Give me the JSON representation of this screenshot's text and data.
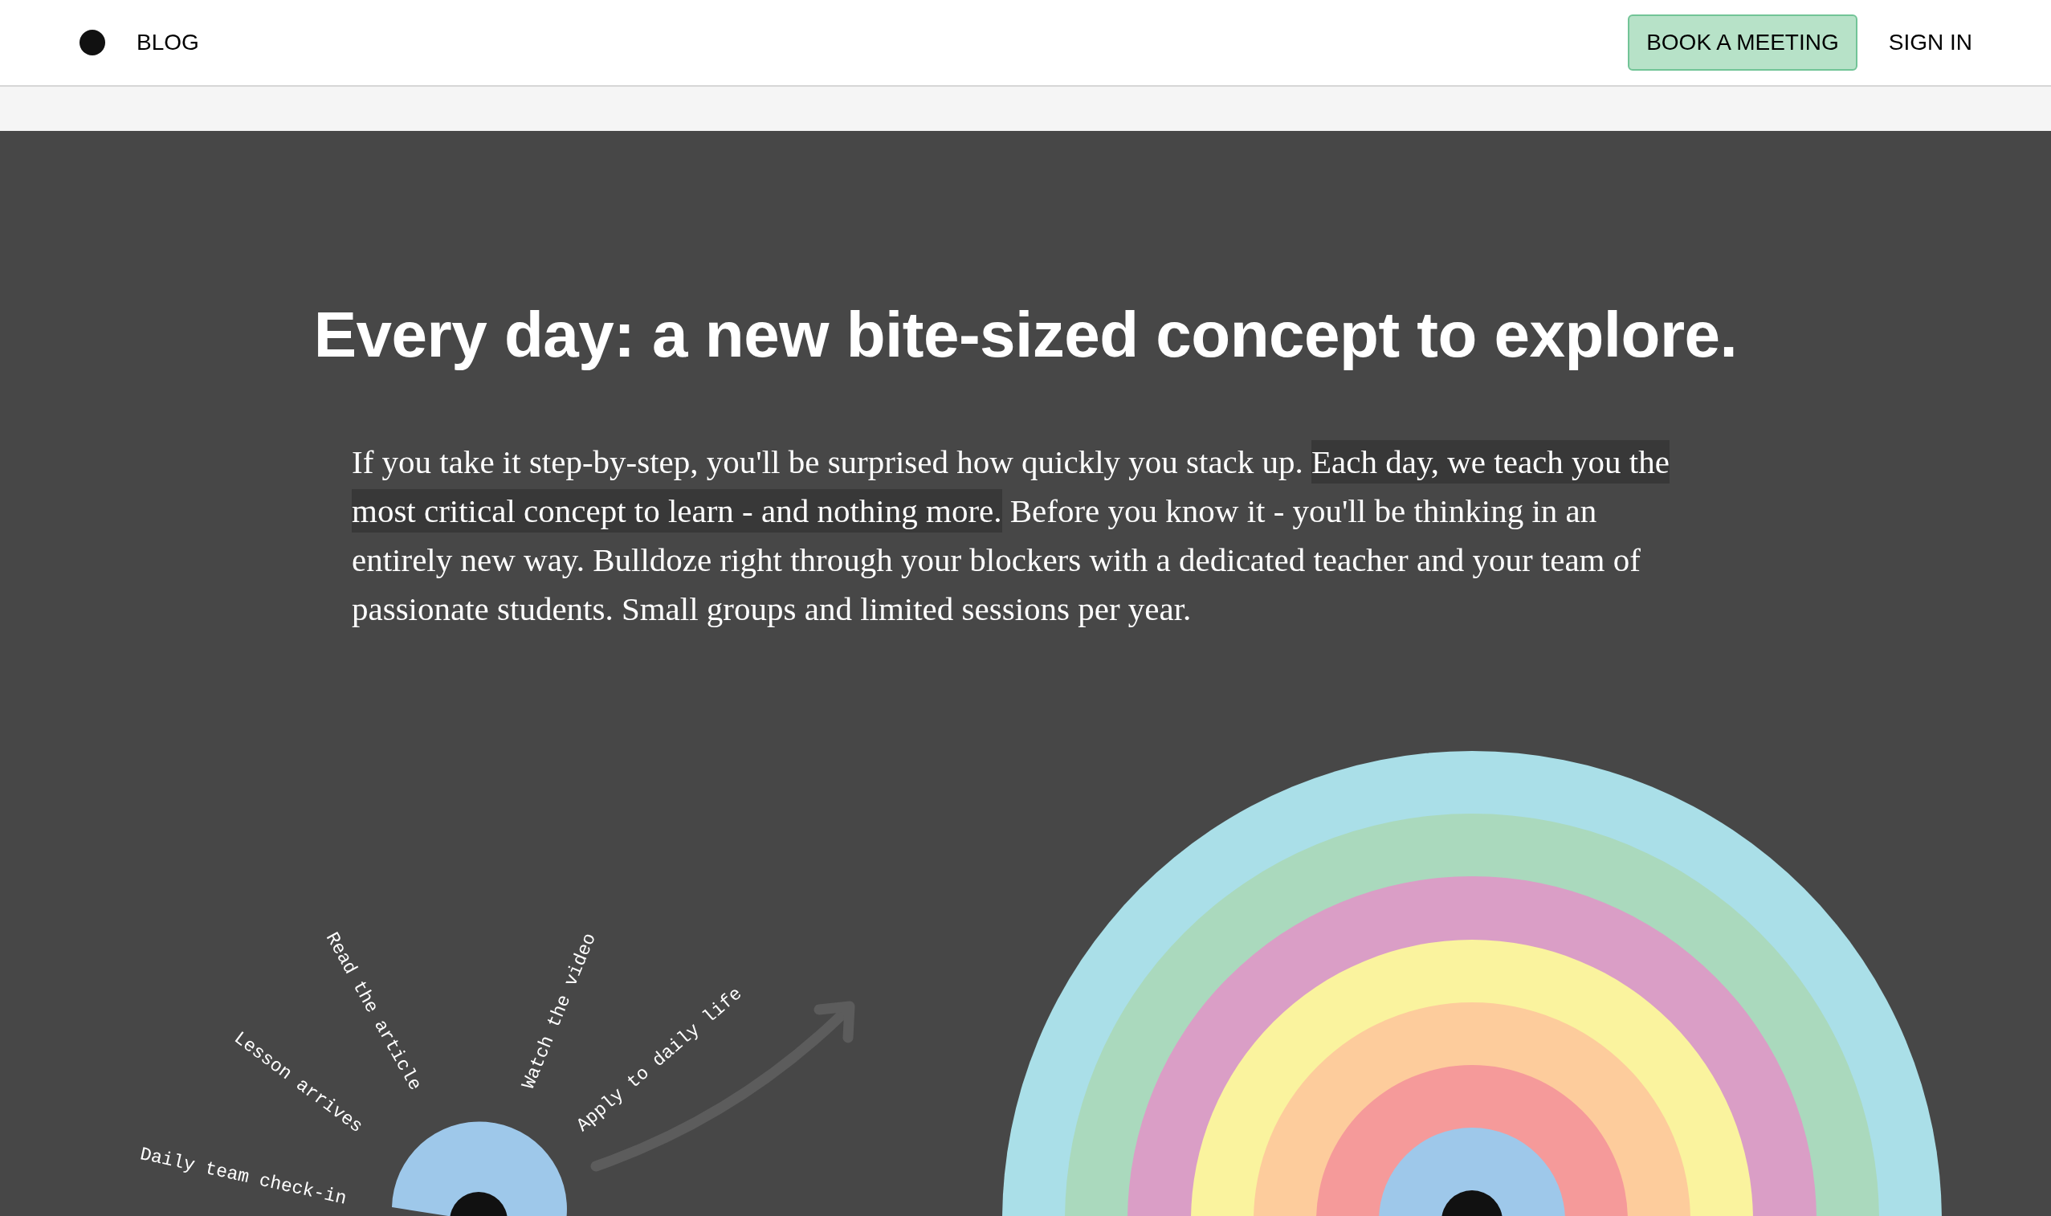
{
  "nav": {
    "blog_link": "BLOG",
    "book_button": "BOOK A MEETING",
    "sign_in_link": "SIGN IN"
  },
  "hero": {
    "title": "Every day: a new bite-sized concept to explore.",
    "paragraph": [
      {
        "text": "If you take it step-by-step, you'll be surprised how quickly you stack up. ",
        "highlighted": false
      },
      {
        "text": "Each day, we teach you the most critical concept to learn - and nothing more.",
        "highlighted": true
      },
      {
        "text": " Before you know it - you'll be thinking in an entirely new way. Bulldoze right through your blockers with a dedicated teacher and your team of passionate students. Small groups and limited sessions per year.",
        "highlighted": false
      }
    ]
  },
  "diagram": {
    "steps": [
      "Daily team check-in",
      "Lesson arrives",
      "Read the article",
      "Watch the video",
      "Apply to daily life"
    ]
  }
}
